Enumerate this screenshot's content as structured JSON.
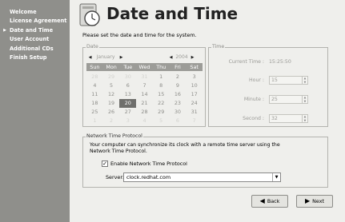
{
  "sidebar": {
    "items": [
      {
        "label": "Welcome",
        "current": false
      },
      {
        "label": "License Agreement",
        "current": false
      },
      {
        "label": "Date and Time",
        "current": true
      },
      {
        "label": "User Account",
        "current": false
      },
      {
        "label": "Additional CDs",
        "current": false
      },
      {
        "label": "Finish Setup",
        "current": false
      }
    ],
    "current_icon": "triangle-right-icon"
  },
  "header": {
    "title": "Date and Time",
    "icon": "clock-icon"
  },
  "intro": "Please set the date and time for the system.",
  "date": {
    "frame_label": "Date",
    "month": "January",
    "year": "2004",
    "weekdays": [
      "Sun",
      "Mon",
      "Tue",
      "Wed",
      "Thu",
      "Fri",
      "Sat"
    ],
    "weeks": [
      [
        {
          "d": "28",
          "f": true
        },
        {
          "d": "29",
          "f": true
        },
        {
          "d": "30",
          "f": true
        },
        {
          "d": "31",
          "f": true
        },
        {
          "d": "1",
          "f": false
        },
        {
          "d": "2",
          "f": false
        },
        {
          "d": "3",
          "f": false
        }
      ],
      [
        {
          "d": "4",
          "f": false
        },
        {
          "d": "5",
          "f": false
        },
        {
          "d": "6",
          "f": false
        },
        {
          "d": "7",
          "f": false
        },
        {
          "d": "8",
          "f": false
        },
        {
          "d": "9",
          "f": false
        },
        {
          "d": "10",
          "f": false
        }
      ],
      [
        {
          "d": "11",
          "f": false
        },
        {
          "d": "12",
          "f": false
        },
        {
          "d": "13",
          "f": false
        },
        {
          "d": "14",
          "f": false
        },
        {
          "d": "15",
          "f": false
        },
        {
          "d": "16",
          "f": false
        },
        {
          "d": "17",
          "f": false
        }
      ],
      [
        {
          "d": "18",
          "f": false
        },
        {
          "d": "19",
          "f": false
        },
        {
          "d": "20",
          "f": false
        },
        {
          "d": "21",
          "f": false
        },
        {
          "d": "22",
          "f": false
        },
        {
          "d": "23",
          "f": false
        },
        {
          "d": "24",
          "f": false
        }
      ],
      [
        {
          "d": "25",
          "f": false
        },
        {
          "d": "26",
          "f": false
        },
        {
          "d": "27",
          "f": false
        },
        {
          "d": "28",
          "f": false
        },
        {
          "d": "29",
          "f": false
        },
        {
          "d": "30",
          "f": false
        },
        {
          "d": "31",
          "f": false
        }
      ],
      [
        {
          "d": "1",
          "f": true
        },
        {
          "d": "2",
          "f": true
        },
        {
          "d": "3",
          "f": true
        },
        {
          "d": "4",
          "f": true
        },
        {
          "d": "5",
          "f": true
        },
        {
          "d": "6",
          "f": true
        },
        {
          "d": "7",
          "f": true
        }
      ]
    ],
    "selected_day": "20"
  },
  "time": {
    "frame_label": "Time",
    "current_time_label": "Current Time :",
    "current_time_value": "15:25:50",
    "hour_label": "Hour :",
    "hour_value": "15",
    "minute_label": "Minute :",
    "minute_value": "25",
    "second_label": "Second :",
    "second_value": "32"
  },
  "ntp": {
    "frame_label": "Network Time Protocol",
    "description": "Your computer can synchronize its clock with a remote time server using the Network Time Protocol.",
    "enable_label": "Enable Network Time Protocol",
    "enable_checked": true,
    "server_label": "Server:",
    "server_value": "clock.redhat.com"
  },
  "buttons": {
    "back": "Back",
    "next": "Next"
  },
  "colors": {
    "sidebar_bg": "#8f8f8b",
    "main_bg": "#efefec",
    "selected_day_bg": "#6f6f6c"
  }
}
